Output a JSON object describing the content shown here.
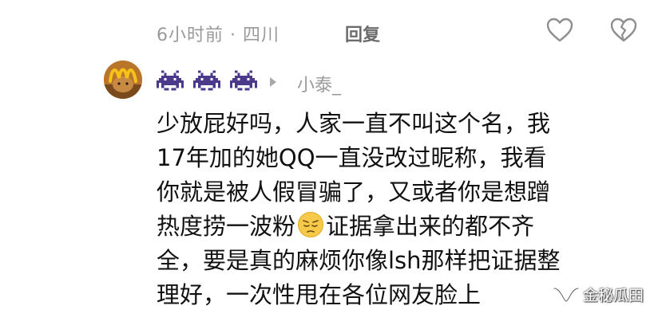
{
  "previous_comment": {
    "meta": "6小时前 · 四川",
    "reply_label": "回复",
    "like_icon": "heart-outline-icon",
    "dislike_icon": "broken-heart-icon"
  },
  "comment": {
    "avatar_icon": "mcdonalds-logo-avatar",
    "badges": [
      "space-invader-icon",
      "space-invader-icon",
      "space-invader-icon"
    ],
    "reply_arrow_icon": "triangle-right-icon",
    "username": "小泰_",
    "lines": [
      "少放屁好吗，人家一直不叫这个名，我",
      "17年加的她QQ一直没改过昵称，我看",
      "你就是被人假冒骗了，又或者你是想蹭",
      "热度捞一波粉",
      "全，要是真的麻烦你像lsh那样把证据整",
      "理好，一次性甩在各位网友脸上"
    ],
    "line4_after_emoji": "证据拿出来的都不齐",
    "emoji": "pensive-face-emoji"
  },
  "watermark": {
    "icon": "wechat-channel-icon",
    "text": "金秘瓜田"
  },
  "colors": {
    "meta_gray": "#9a9a9a",
    "text_black": "#111111",
    "alien_purple": "#4b3a8c",
    "avatar_orange": "#b9762a",
    "emoji_yellow": "#f7c948"
  }
}
